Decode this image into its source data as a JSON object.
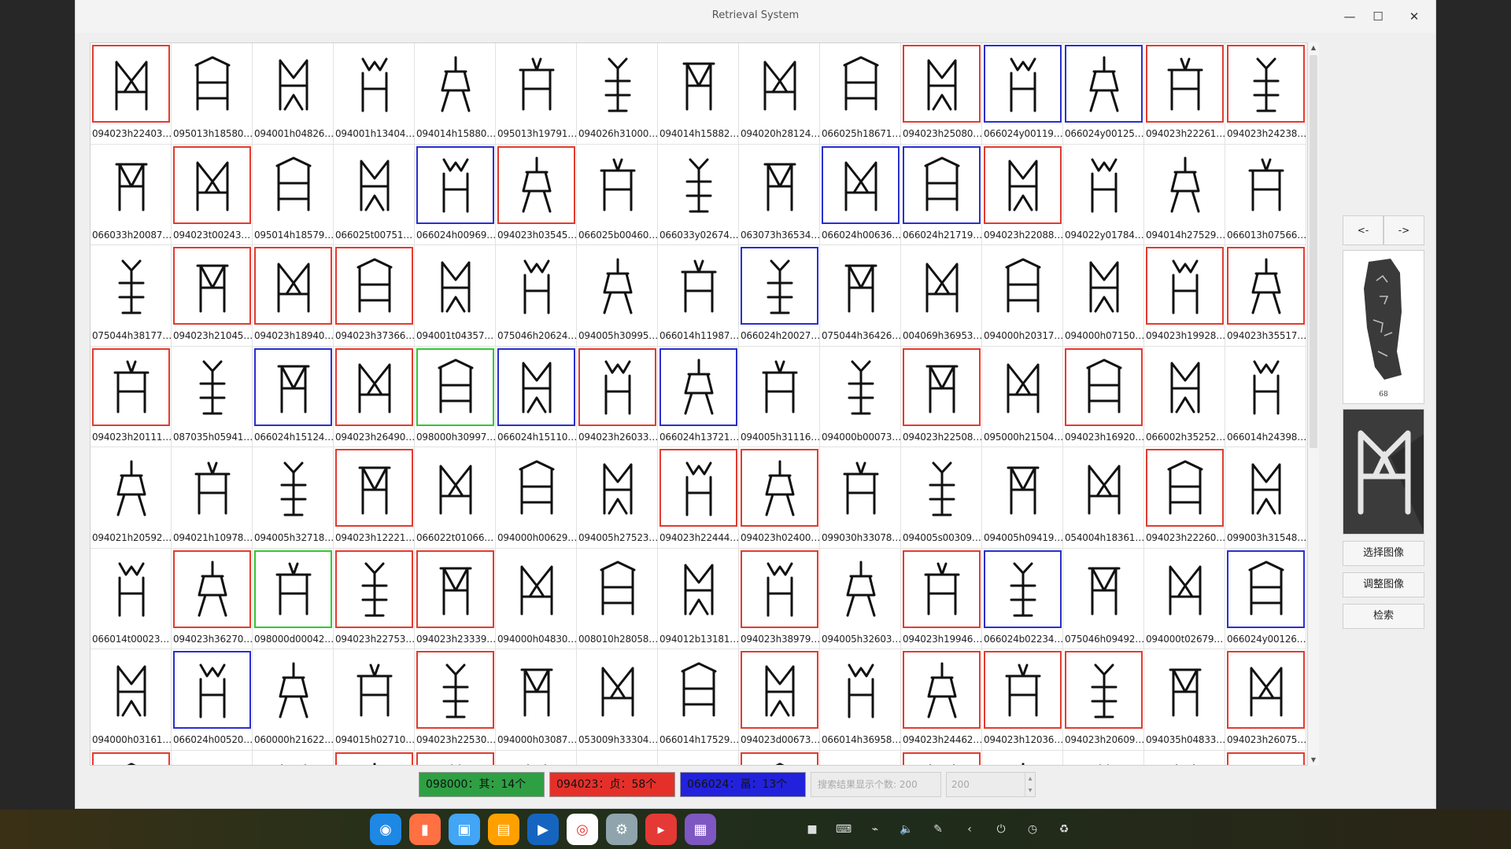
{
  "window": {
    "title": "Retrieval System",
    "minimize_glyph": "—",
    "maximize_glyph": "☐",
    "close_glyph": "✕"
  },
  "border_colors": {
    "red": "#e33b2e",
    "blue": "#2a2fcf",
    "green": "#32c832"
  },
  "grid": {
    "columns": 15,
    "items": [
      {
        "id": "094023h22403…",
        "border": "red"
      },
      {
        "id": "095013h18580…",
        "border": "none"
      },
      {
        "id": "094001h04826…",
        "border": "none"
      },
      {
        "id": "094001h13404…",
        "border": "none"
      },
      {
        "id": "094014h15880…",
        "border": "none"
      },
      {
        "id": "095013h19791…",
        "border": "none"
      },
      {
        "id": "094026h31000…",
        "border": "none"
      },
      {
        "id": "094014h15882…",
        "border": "none"
      },
      {
        "id": "094020h28124…",
        "border": "none"
      },
      {
        "id": "066025h18671…",
        "border": "none"
      },
      {
        "id": "094023h25080…",
        "border": "red"
      },
      {
        "id": "066024y00119…",
        "border": "blue"
      },
      {
        "id": "066024y00125…",
        "border": "blue"
      },
      {
        "id": "094023h22261…",
        "border": "red"
      },
      {
        "id": "094023h24238…",
        "border": "red"
      },
      {
        "id": "066033h20087…",
        "border": "none"
      },
      {
        "id": "094023t00243…",
        "border": "red"
      },
      {
        "id": "095014h18579…",
        "border": "none"
      },
      {
        "id": "066025t00751…",
        "border": "none"
      },
      {
        "id": "066024h00969…",
        "border": "blue"
      },
      {
        "id": "094023h03545…",
        "border": "red"
      },
      {
        "id": "066025b00460…",
        "border": "none"
      },
      {
        "id": "066033y02674…",
        "border": "none"
      },
      {
        "id": "063073h36534…",
        "border": "none"
      },
      {
        "id": "066024h00636…",
        "border": "blue"
      },
      {
        "id": "066024h21719…",
        "border": "blue"
      },
      {
        "id": "094023h22088…",
        "border": "red"
      },
      {
        "id": "094022y01784…",
        "border": "none"
      },
      {
        "id": "094014h27529…",
        "border": "none"
      },
      {
        "id": "066013h07566…",
        "border": "none"
      },
      {
        "id": "075044h38177…",
        "border": "none"
      },
      {
        "id": "094023h21045…",
        "border": "red"
      },
      {
        "id": "094023h18940…",
        "border": "red"
      },
      {
        "id": "094023h37366…",
        "border": "red"
      },
      {
        "id": "094001t04357…",
        "border": "none"
      },
      {
        "id": "075046h20624…",
        "border": "none"
      },
      {
        "id": "094005h30995…",
        "border": "none"
      },
      {
        "id": "066014h11987…",
        "border": "none"
      },
      {
        "id": "066024h20027…",
        "border": "blue"
      },
      {
        "id": "075044h36426…",
        "border": "none"
      },
      {
        "id": "004069h36953…",
        "border": "none"
      },
      {
        "id": "094000h20317…",
        "border": "none"
      },
      {
        "id": "094000h07150…",
        "border": "none"
      },
      {
        "id": "094023h19928…",
        "border": "red"
      },
      {
        "id": "094023h35517…",
        "border": "red"
      },
      {
        "id": "094023h20111…",
        "border": "red"
      },
      {
        "id": "087035h05941…",
        "border": "none"
      },
      {
        "id": "066024h15124…",
        "border": "blue"
      },
      {
        "id": "094023h26490…",
        "border": "red"
      },
      {
        "id": "098000h30997…",
        "border": "green"
      },
      {
        "id": "066024h15110…",
        "border": "blue"
      },
      {
        "id": "094023h26033…",
        "border": "red"
      },
      {
        "id": "066024h13721…",
        "border": "blue"
      },
      {
        "id": "094005h31116…",
        "border": "none"
      },
      {
        "id": "094000b00073…",
        "border": "none"
      },
      {
        "id": "094023h22508…",
        "border": "red"
      },
      {
        "id": "095000h21504…",
        "border": "none"
      },
      {
        "id": "094023h16920…",
        "border": "red"
      },
      {
        "id": "066002h35252…",
        "border": "none"
      },
      {
        "id": "066014h24398…",
        "border": "none"
      },
      {
        "id": "094021h20592…",
        "border": "none"
      },
      {
        "id": "094021h10978…",
        "border": "none"
      },
      {
        "id": "094005h32718…",
        "border": "none"
      },
      {
        "id": "094023h12221…",
        "border": "red"
      },
      {
        "id": "066022t01066…",
        "border": "none"
      },
      {
        "id": "094000h00629…",
        "border": "none"
      },
      {
        "id": "094005h27523…",
        "border": "none"
      },
      {
        "id": "094023h22444…",
        "border": "red"
      },
      {
        "id": "094023h02400…",
        "border": "red"
      },
      {
        "id": "099030h33078…",
        "border": "none"
      },
      {
        "id": "094005s00309…",
        "border": "none"
      },
      {
        "id": "094005h09419…",
        "border": "none"
      },
      {
        "id": "054004h18361…",
        "border": "none"
      },
      {
        "id": "094023h22260…",
        "border": "red"
      },
      {
        "id": "099003h31548…",
        "border": "none"
      },
      {
        "id": "066014t00023…",
        "border": "none"
      },
      {
        "id": "094023h36270…",
        "border": "red"
      },
      {
        "id": "098000d00042…",
        "border": "green"
      },
      {
        "id": "094023h22753…",
        "border": "red"
      },
      {
        "id": "094023h23339…",
        "border": "red"
      },
      {
        "id": "094000h04830…",
        "border": "none"
      },
      {
        "id": "008010h28058…",
        "border": "none"
      },
      {
        "id": "094012b13181…",
        "border": "none"
      },
      {
        "id": "094023h38979…",
        "border": "red"
      },
      {
        "id": "094005h32603…",
        "border": "none"
      },
      {
        "id": "094023h19946…",
        "border": "red"
      },
      {
        "id": "066024b02234…",
        "border": "blue"
      },
      {
        "id": "075046h09492…",
        "border": "none"
      },
      {
        "id": "094000t02679…",
        "border": "none"
      },
      {
        "id": "066024y00126…",
        "border": "blue"
      },
      {
        "id": "094000h03161…",
        "border": "none"
      },
      {
        "id": "066024h00520…",
        "border": "blue"
      },
      {
        "id": "060000h21622…",
        "border": "none"
      },
      {
        "id": "094015h02710…",
        "border": "none"
      },
      {
        "id": "094023h22530…",
        "border": "red"
      },
      {
        "id": "094000h03087…",
        "border": "none"
      },
      {
        "id": "053009h33304…",
        "border": "none"
      },
      {
        "id": "066014h17529…",
        "border": "none"
      },
      {
        "id": "094023d00673…",
        "border": "red"
      },
      {
        "id": "066014h36958…",
        "border": "none"
      },
      {
        "id": "094023h24462…",
        "border": "red"
      },
      {
        "id": "094023h12036…",
        "border": "red"
      },
      {
        "id": "094023h20609…",
        "border": "red"
      },
      {
        "id": "094035h04833…",
        "border": "none"
      },
      {
        "id": "094023h26075…",
        "border": "red"
      },
      {
        "id": "",
        "border": "red"
      },
      {
        "id": "",
        "border": "none"
      },
      {
        "id": "",
        "border": "none"
      },
      {
        "id": "",
        "border": "red"
      },
      {
        "id": "",
        "border": "red"
      },
      {
        "id": "",
        "border": "none"
      },
      {
        "id": "",
        "border": "none"
      },
      {
        "id": "",
        "border": "none"
      },
      {
        "id": "",
        "border": "red"
      },
      {
        "id": "",
        "border": "none"
      },
      {
        "id": "",
        "border": "red"
      },
      {
        "id": "",
        "border": "none"
      },
      {
        "id": "",
        "border": "none"
      },
      {
        "id": "",
        "border": "none"
      },
      {
        "id": "",
        "border": "red"
      }
    ]
  },
  "side_panel": {
    "prev_label": "<-",
    "next_label": "->",
    "preview_caption": "68",
    "select_image_label": "选择图像",
    "adjust_image_label": "调整图像",
    "search_label": "检索"
  },
  "status": {
    "green_text": "098000：其：14个",
    "red_text": "094023：贞：58个",
    "blue_text": "066024：畐：13个",
    "count_placeholder": "搜索结果显示个数: 200",
    "count_value": "200"
  },
  "dock_icons": [
    "deepin-launcher-icon",
    "recorder-icon",
    "file-manager-icon",
    "archive-icon",
    "video-player-icon",
    "chrome-icon",
    "settings-icon",
    "terminal-icon",
    "app-store-icon"
  ],
  "tray_icons": [
    "camera-icon",
    "keyboard-icon",
    "usb-icon",
    "volume-icon",
    "pen-icon",
    "chevron-left-icon",
    "power-icon",
    "clock-icon",
    "trash-icon"
  ]
}
